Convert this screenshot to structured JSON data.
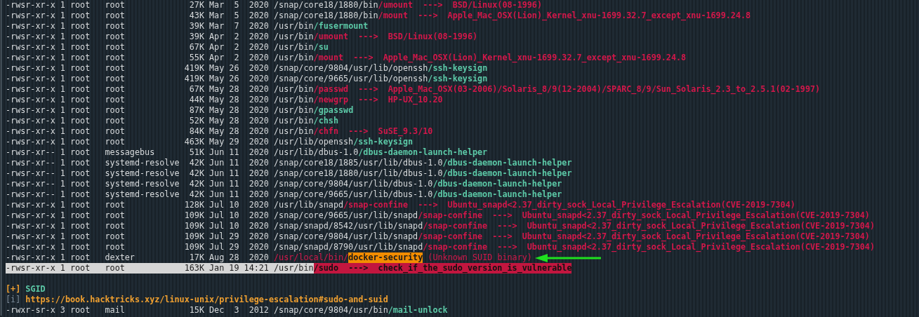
{
  "lines": [
    {
      "kind": "entry",
      "selected": false,
      "segments": [
        {
          "kind": "text",
          "text": "-rwsr-xr-x 1 root   root             27K Mar  5  2020 /snap/core18/1880/bin"
        },
        {
          "kind": "vuln",
          "text": "/umount  --->  BSD/Linux(08-1996)"
        }
      ]
    },
    {
      "kind": "entry",
      "selected": false,
      "segments": [
        {
          "kind": "text",
          "text": "-rwsr-xr-x 1 root   root             43K Mar  5  2020 /snap/core18/1880/bin"
        },
        {
          "kind": "vuln",
          "text": "/mount  --->  Apple_Mac_OSX(Lion)_Kernel_xnu-1699.32.7_except_xnu-1699.24.8"
        }
      ]
    },
    {
      "kind": "entry",
      "selected": false,
      "segments": [
        {
          "kind": "text",
          "text": "-rwsr-xr-x 1 root   root             39K Mar  7  2020 /usr/bin"
        },
        {
          "kind": "safe",
          "text": "/fusermount"
        }
      ]
    },
    {
      "kind": "entry",
      "selected": false,
      "segments": [
        {
          "kind": "text",
          "text": "-rwsr-xr-x 1 root   root             39K Apr  2  2020 /usr/bin"
        },
        {
          "kind": "vuln",
          "text": "/umount  --->  BSD/Linux(08-1996)"
        }
      ]
    },
    {
      "kind": "entry",
      "selected": false,
      "segments": [
        {
          "kind": "text",
          "text": "-rwsr-xr-x 1 root   root             67K Apr  2  2020 /usr/bin"
        },
        {
          "kind": "safe",
          "text": "/su"
        }
      ]
    },
    {
      "kind": "entry",
      "selected": false,
      "segments": [
        {
          "kind": "text",
          "text": "-rwsr-xr-x 1 root   root             55K Apr  2  2020 /usr/bin"
        },
        {
          "kind": "vuln",
          "text": "/mount  --->  Apple_Mac_OSX(Lion)_Kernel_xnu-1699.32.7_except_xnu-1699.24.8"
        }
      ]
    },
    {
      "kind": "entry",
      "selected": false,
      "segments": [
        {
          "kind": "text",
          "text": "-rwsr-xr-x 1 root   root            419K May 26  2020 /snap/core/9804/usr/lib/openssh"
        },
        {
          "kind": "safe",
          "text": "/ssh-keysign"
        }
      ]
    },
    {
      "kind": "entry",
      "selected": false,
      "segments": [
        {
          "kind": "text",
          "text": "-rwsr-xr-x 1 root   root            419K May 26  2020 /snap/core/9665/usr/lib/openssh"
        },
        {
          "kind": "safe",
          "text": "/ssh-keysign"
        }
      ]
    },
    {
      "kind": "entry",
      "selected": false,
      "segments": [
        {
          "kind": "text",
          "text": "-rwsr-xr-x 1 root   root             67K May 28  2020 /usr/bin"
        },
        {
          "kind": "vuln",
          "text": "/passwd  --->  Apple_Mac_OSX(03-2006)/Solaris_8/9(12-2004)/SPARC_8/9/Sun_Solaris_2.3_to_2.5.1(02-1997)"
        }
      ]
    },
    {
      "kind": "entry",
      "selected": false,
      "segments": [
        {
          "kind": "text",
          "text": "-rwsr-xr-x 1 root   root             44K May 28  2020 /usr/bin"
        },
        {
          "kind": "vuln",
          "text": "/newgrp  --->  HP-UX_10.20"
        }
      ]
    },
    {
      "kind": "entry",
      "selected": false,
      "segments": [
        {
          "kind": "text",
          "text": "-rwsr-xr-x 1 root   root             87K May 28  2020 /usr/bin"
        },
        {
          "kind": "safe",
          "text": "/gpasswd"
        }
      ]
    },
    {
      "kind": "entry",
      "selected": false,
      "segments": [
        {
          "kind": "text",
          "text": "-rwsr-xr-x 1 root   root             52K May 28  2020 /usr/bin"
        },
        {
          "kind": "safe",
          "text": "/chsh"
        }
      ]
    },
    {
      "kind": "entry",
      "selected": false,
      "segments": [
        {
          "kind": "text",
          "text": "-rwsr-xr-x 1 root   root             84K May 28  2020 /usr/bin"
        },
        {
          "kind": "vuln",
          "text": "/chfn  --->  SuSE_9.3/10"
        }
      ]
    },
    {
      "kind": "entry",
      "selected": false,
      "segments": [
        {
          "kind": "text",
          "text": "-rwsr-xr-x 1 root   root            463K May 29  2020 /usr/lib/openssh"
        },
        {
          "kind": "safe",
          "text": "/ssh-keysign"
        }
      ]
    },
    {
      "kind": "entry",
      "selected": false,
      "segments": [
        {
          "kind": "text",
          "text": "-rwsr-xr-- 1 root   messagebus       51K Jun 11  2020 /usr/lib/dbus-1.0"
        },
        {
          "kind": "safe",
          "text": "/dbus-daemon-launch-helper"
        }
      ]
    },
    {
      "kind": "entry",
      "selected": false,
      "segments": [
        {
          "kind": "text",
          "text": "-rwsr-xr-- 1 root   systemd-resolve  42K Jun 11  2020 /snap/core18/1885/usr/lib/dbus-1.0"
        },
        {
          "kind": "safe",
          "text": "/dbus-daemon-launch-helper"
        }
      ]
    },
    {
      "kind": "entry",
      "selected": false,
      "segments": [
        {
          "kind": "text",
          "text": "-rwsr-xr-- 1 root   systemd-resolve  42K Jun 11  2020 /snap/core18/1880/usr/lib/dbus-1.0"
        },
        {
          "kind": "safe",
          "text": "/dbus-daemon-launch-helper"
        }
      ]
    },
    {
      "kind": "entry",
      "selected": false,
      "segments": [
        {
          "kind": "text",
          "text": "-rwsr-xr-- 1 root   systemd-resolve  42K Jun 11  2020 /snap/core/9804/usr/lib/dbus-1.0"
        },
        {
          "kind": "safe",
          "text": "/dbus-daemon-launch-helper"
        }
      ]
    },
    {
      "kind": "entry",
      "selected": false,
      "segments": [
        {
          "kind": "text",
          "text": "-rwsr-xr-- 1 root   systemd-resolve  42K Jun 11  2020 /snap/core/9665/usr/lib/dbus-1.0"
        },
        {
          "kind": "safe",
          "text": "/dbus-daemon-launch-helper"
        }
      ]
    },
    {
      "kind": "entry",
      "selected": false,
      "segments": [
        {
          "kind": "text",
          "text": "-rwsr-xr-x 1 root   root            128K Jul 10  2020 /usr/lib/snapd"
        },
        {
          "kind": "vuln",
          "text": "/snap-confine  --->  Ubuntu_snapd<2.37_dirty_sock_Local_Privilege_Escalation(CVE-2019-7304)"
        }
      ]
    },
    {
      "kind": "entry",
      "selected": false,
      "segments": [
        {
          "kind": "text",
          "text": "-rwsr-xr-x 1 root   root            109K Jul 10  2020 /snap/core/9665/usr/lib/snapd"
        },
        {
          "kind": "vuln",
          "text": "/snap-confine  --->  Ubuntu_snapd<2.37_dirty_sock_Local_Privilege_Escalation(CVE-2019-7304)"
        }
      ]
    },
    {
      "kind": "entry",
      "selected": false,
      "segments": [
        {
          "kind": "text",
          "text": "-rwsr-xr-x 1 root   root            109K Jul 10  2020 /snap/snapd/8542/usr/lib/snapd"
        },
        {
          "kind": "vuln",
          "text": "/snap-confine  --->  Ubuntu_snapd<2.37_dirty_sock_Local_Privilege_Escalation(CVE-2019-7304)"
        }
      ]
    },
    {
      "kind": "entry",
      "selected": false,
      "segments": [
        {
          "kind": "text",
          "text": "-rwsr-xr-x 1 root   root            109K Jul 29  2020 /snap/core/9804/usr/lib/snapd"
        },
        {
          "kind": "vuln",
          "text": "/snap-confine  --->  Ubuntu_snapd<2.37_dirty_sock_Local_Privilege_Escalation(CVE-2019-7304)"
        }
      ]
    },
    {
      "kind": "entry",
      "selected": false,
      "segments": [
        {
          "kind": "text",
          "text": "-rwsr-xr-x 1 root   root            109K Jul 29  2020 /snap/snapd/8790/usr/lib/snapd"
        },
        {
          "kind": "vuln",
          "text": "/snap-confine  --->  Ubuntu_snapd<2.37_dirty_sock_Local_Privilege_Escalation(CVE-2019-7304)"
        }
      ]
    },
    {
      "kind": "entry",
      "selected": false,
      "segments": [
        {
          "kind": "text",
          "text": "-rwsr-xr-x 1 root   dexter           17K Aug 28  2020"
        },
        {
          "kind": "flagged",
          "text": "/usr/local/bin/"
        },
        {
          "kind": "highlight",
          "text": "docker-security"
        },
        {
          "kind": "flagged",
          "text": "(Unknown SUID binary)"
        },
        {
          "kind": "arrow"
        }
      ]
    },
    {
      "kind": "entry",
      "selected": true,
      "segments": [
        {
          "kind": "text",
          "text": "-rwsr-xr-x 1 root   root            163K Jan 19 14:21 /usr/bin"
        },
        {
          "kind": "critical",
          "text": "/sudo  --->  check_if_the_sudo_version_is_vulnerable"
        }
      ]
    },
    {
      "kind": "section",
      "selected": false,
      "segments": [
        {
          "kind": "prefix",
          "text": "[+]"
        },
        {
          "kind": "heading",
          "text": "SGID"
        }
      ]
    },
    {
      "kind": "entry",
      "selected": false,
      "segments": [
        {
          "kind": "info",
          "text": "[i]"
        },
        {
          "kind": "link",
          "text": "https://book.hacktricks.xyz/linux-unix/privilege-escalation#sudo-and-suid"
        }
      ]
    },
    {
      "kind": "entry",
      "selected": false,
      "segments": [
        {
          "kind": "text",
          "text": "-rwxr-sr-x 3 root   mail             15K Dec  3  2012 /snap/core/9804/usr/bin"
        },
        {
          "kind": "safe",
          "text": "/mail-unlock"
        }
      ]
    }
  ]
}
